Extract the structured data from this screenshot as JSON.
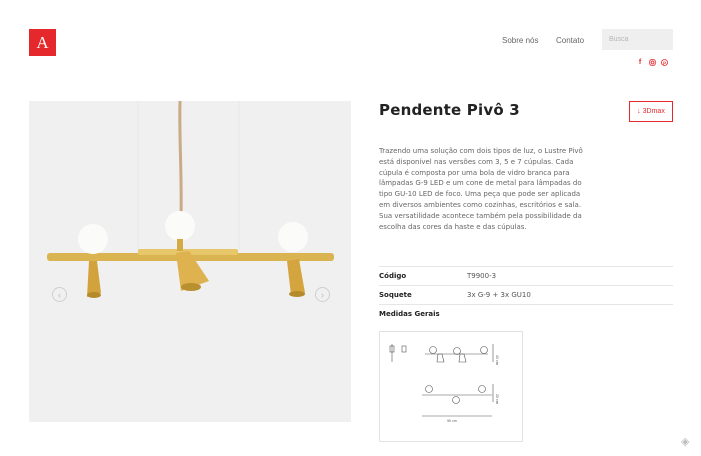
{
  "header": {
    "logo_text": "A",
    "nav": [
      "Sobre nós",
      "Contato"
    ],
    "search_placeholder": "Busca",
    "social": [
      "pinterest-like-icon",
      "instagram-icon",
      "pinterest-icon"
    ]
  },
  "product": {
    "title": "Pendente Pivô 3",
    "btn_3d": "3Dmax",
    "description": "Trazendo uma solução com dois tipos de luz, o Lustre Pivô está disponível nas versões com 3, 5 e 7 cúpulas. Cada cúpula é composta por uma bola de vidro branca para lâmpadas G-9 LED e um cone de metal para lâmpadas do tipo GU-10 LED de foco. Uma peça que pode ser aplicada em diversos ambientes como cozinhas, escritórios e sala. Sua versatilidade acontece também pela possibilidade da escolha das cores da haste e das cúpulas.",
    "specs": [
      {
        "key": "Código",
        "value": "T9900-3"
      },
      {
        "key": "Soquete",
        "value": "3x G-9 + 3x GU10"
      },
      {
        "key": "Medidas Gerais",
        "value": ""
      }
    ],
    "drawing_dims": {
      "height_a": "45 cm",
      "height_b": "20 cm",
      "width": "90 cm"
    }
  }
}
